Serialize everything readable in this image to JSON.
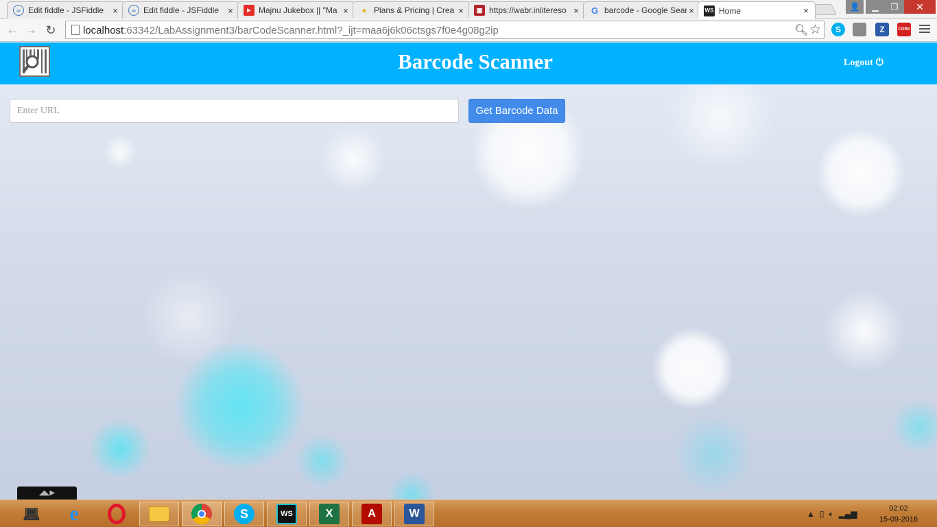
{
  "browser": {
    "tabs": [
      {
        "title": "Edit fiddle - JSFiddle",
        "icon": "jsfiddle-icon",
        "active": false
      },
      {
        "title": "Edit fiddle - JSFiddle",
        "icon": "jsfiddle-icon",
        "active": false
      },
      {
        "title": "Majnu Jukebox || \"Ma",
        "icon": "youtube-icon",
        "active": false
      },
      {
        "title": "Plans & Pricing | Crea",
        "icon": "lightbulb-icon",
        "active": false
      },
      {
        "title": "https://wabr.inlitereso",
        "icon": "wabr-icon",
        "active": false
      },
      {
        "title": "barcode - Google Sear",
        "icon": "google-icon",
        "active": false
      },
      {
        "title": "Home",
        "icon": "webstorm-icon",
        "active": true
      }
    ],
    "close_glyph": "×",
    "url_host": "localhost",
    "url_rest": ":63342/LabAssignment3/barCodeScanner.html?_ijt=maa6j6k06ctsgs7f0e4g08g2ip",
    "extensions": [
      {
        "name": "skype-extension-icon",
        "label": "S",
        "color": "#00aff0"
      },
      {
        "name": "shield-extension-icon",
        "label": "",
        "color": "#888888"
      },
      {
        "name": "zotero-extension-icon",
        "label": "Z",
        "color": "#2b5aa8"
      },
      {
        "name": "cors-extension-icon",
        "label": "CORS",
        "color": "#d32020"
      }
    ]
  },
  "app": {
    "title": "Barcode Scanner",
    "logout_label": "Logout",
    "header_color": "#00b2ff",
    "url_placeholder": "Enter URL",
    "url_value": "",
    "get_button_label": "Get Barcode Data",
    "button_color": "#428bea"
  },
  "taskbar": {
    "items": [
      {
        "name": "laptop-icon",
        "state": "none"
      },
      {
        "name": "internet-explorer-icon",
        "state": "none"
      },
      {
        "name": "opera-icon",
        "state": "none"
      },
      {
        "name": "file-explorer-icon",
        "state": "pinned"
      },
      {
        "name": "chrome-icon",
        "state": "open"
      },
      {
        "name": "skype-icon",
        "state": "pinned"
      },
      {
        "name": "webstorm-icon",
        "state": "pinned"
      },
      {
        "name": "excel-icon",
        "state": "pinned"
      },
      {
        "name": "acrobat-icon",
        "state": "pinned"
      },
      {
        "name": "word-icon",
        "state": "pinned"
      }
    ],
    "time": "02:02",
    "date": "15-09-2016"
  }
}
